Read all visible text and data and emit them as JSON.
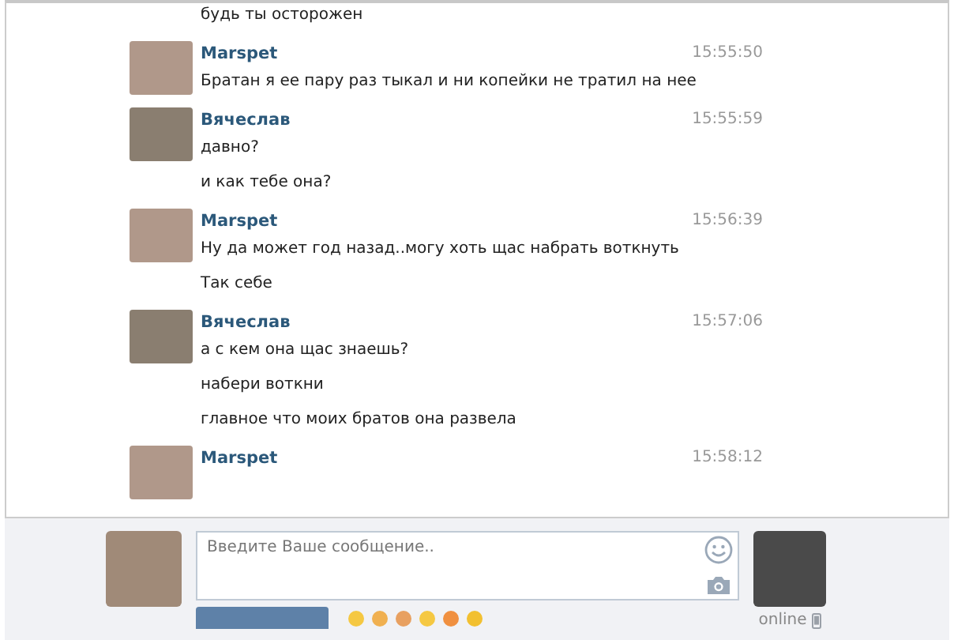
{
  "messages": [
    {
      "kind": "continuation",
      "lines": [
        "будь ты осторожен"
      ]
    },
    {
      "kind": "group",
      "author": "Marspet",
      "time": "15:55:50",
      "lines": [
        "Братан я ее пару раз тыкал и ни копейки не тратил на нее"
      ]
    },
    {
      "kind": "group",
      "author": "Вячеслав",
      "time": "15:55:59",
      "lines": [
        "давно?",
        "и как тебе она?"
      ]
    },
    {
      "kind": "group",
      "author": "Marspet",
      "time": "15:56:39",
      "lines": [
        "Ну да может год назад..могу хоть щас набрать воткнуть",
        "Так себе"
      ]
    },
    {
      "kind": "group",
      "author": "Вячеслав",
      "time": "15:57:06",
      "lines": [
        "а с кем она щас знаешь?",
        "набери воткни",
        "главное что моих братов она развела"
      ]
    },
    {
      "kind": "group",
      "author": "Marspet",
      "time": "15:58:12"
    }
  ],
  "composer": {
    "placeholder": "Введите Ваше сообщение..",
    "partner_status": "online"
  }
}
